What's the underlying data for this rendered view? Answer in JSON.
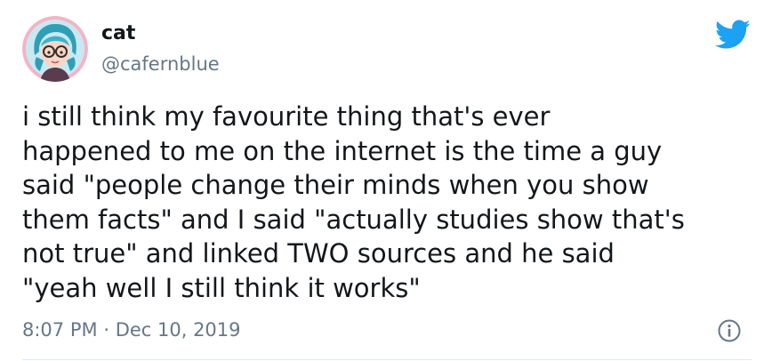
{
  "tweet": {
    "user": {
      "name": "cat",
      "handle": "@cafernblue",
      "avatar_icon": "avatar-illustration"
    },
    "text": "i still think my favourite thing that's ever\nhappened to me on the internet is the time a guy\nsaid \"people change their minds when you show\nthem facts\" and I said \"actually studies show that's\nnot true\" and linked TWO sources and he said\n\"yeah well I still think it works\"",
    "time": "8:07 PM",
    "separator": "·",
    "date": "Dec 10, 2019",
    "icons": {
      "brand": "twitter-bird-icon",
      "info": "info-icon"
    },
    "colors": {
      "brand_blue": "#1da1f2",
      "text": "#14171a",
      "secondary": "#657786"
    }
  }
}
